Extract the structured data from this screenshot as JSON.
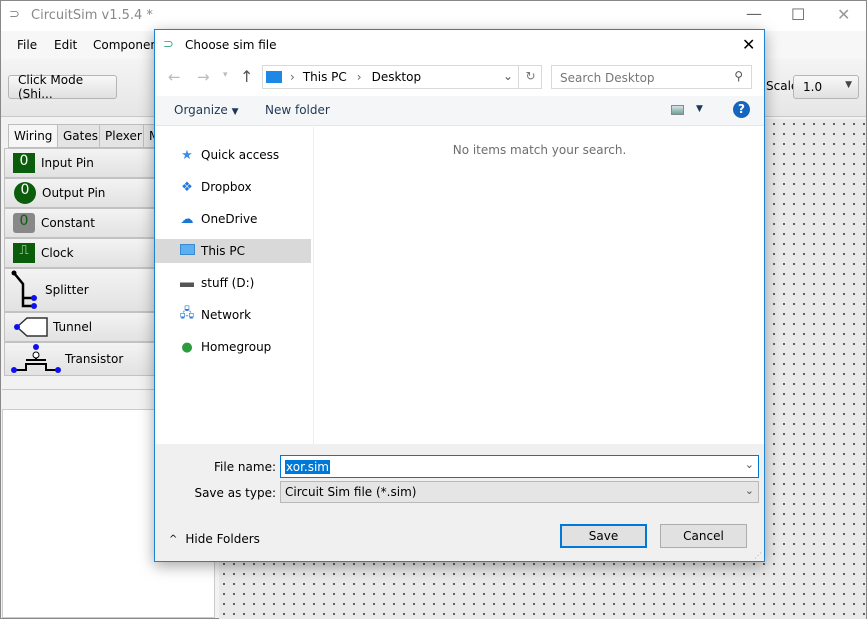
{
  "main": {
    "title": "CircuitSim v1.5.4 *",
    "menu": [
      "File",
      "Edit",
      "Components"
    ],
    "click_mode": "Click Mode (Shi...",
    "scale_label": "Scale:",
    "scale_value": "1.0",
    "tabs": [
      "Wiring",
      "Gates",
      "Plexer",
      "M"
    ],
    "components": [
      "Input Pin",
      "Output Pin",
      "Constant",
      "Clock",
      "Splitter",
      "Tunnel",
      "Transistor"
    ],
    "pin_value": "0"
  },
  "dialog": {
    "title": "Choose sim file",
    "breadcrumb": [
      "This PC",
      "Desktop"
    ],
    "search_placeholder": "Search Desktop",
    "organize": "Organize",
    "new_folder": "New folder",
    "nav": [
      {
        "label": "Quick access",
        "icon": "star-icon"
      },
      {
        "label": "Dropbox",
        "icon": "dropbox-icon"
      },
      {
        "label": "OneDrive",
        "icon": "cloud-icon"
      },
      {
        "label": "This PC",
        "icon": "computer-icon",
        "selected": true
      },
      {
        "label": "stuff (D:)",
        "icon": "drive-icon"
      },
      {
        "label": "Network",
        "icon": "network-icon"
      },
      {
        "label": "Homegroup",
        "icon": "homegroup-icon"
      }
    ],
    "empty_message": "No items match your search.",
    "file_name_label": "File name:",
    "file_name": "xor.sim",
    "save_type_label": "Save as type:",
    "save_type": "Circuit Sim file (*.sim)",
    "hide_folders": "Hide Folders",
    "save": "Save",
    "cancel": "Cancel"
  },
  "colors": {
    "accent": "#0078d7",
    "component_green": "#0b5d0b",
    "pin_blue": "#1010ee"
  }
}
